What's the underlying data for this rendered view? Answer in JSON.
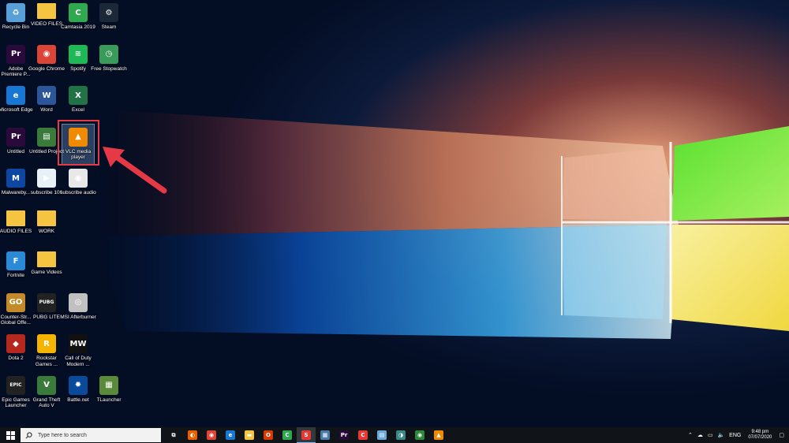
{
  "desktop": {
    "icons": [
      {
        "label": "Recycle Bin",
        "icon": "recycle-bin-icon",
        "glyph": "♻",
        "color": "#5aa0d8"
      },
      {
        "label": "VIDEO FILES",
        "icon": "folder-icon",
        "glyph": "",
        "color": "#f5c542"
      },
      {
        "label": "Camtasia 2019",
        "icon": "camtasia-icon",
        "glyph": "C",
        "color": "#2fa84f"
      },
      {
        "label": "Steam",
        "icon": "steam-icon",
        "glyph": "⚙",
        "color": "#1b2838"
      },
      {
        "label": "Adobe Premiere P...",
        "icon": "premiere-icon",
        "glyph": "Pr",
        "color": "#2a0a3a"
      },
      {
        "label": "Google Chrome",
        "icon": "chrome-icon",
        "glyph": "◉",
        "color": "#db4437"
      },
      {
        "label": "Spotify",
        "icon": "spotify-icon",
        "glyph": "≋",
        "color": "#1db954"
      },
      {
        "label": "Free Stopwatch",
        "icon": "stopwatch-icon",
        "glyph": "◷",
        "color": "#3a9a5a"
      },
      {
        "label": "Microsoft Edge",
        "icon": "edge-icon",
        "glyph": "e",
        "color": "#1877d2"
      },
      {
        "label": "Word",
        "icon": "word-icon",
        "glyph": "W",
        "color": "#2b579a"
      },
      {
        "label": "Excel",
        "icon": "excel-icon",
        "glyph": "X",
        "color": "#217346"
      },
      {
        "label": "Untitled",
        "icon": "premiere-project-icon",
        "glyph": "Pr",
        "color": "#2a0a3a"
      },
      {
        "label": "Untitled Project",
        "icon": "camtasia-project-icon",
        "glyph": "▤",
        "color": "#3a7a3a"
      },
      {
        "label": "VLC media player",
        "icon": "vlc-icon",
        "glyph": "▲",
        "color": "#f08a00"
      },
      {
        "label": "Malwareby...",
        "icon": "malwarebytes-icon",
        "glyph": "M",
        "color": "#0d47a1"
      },
      {
        "label": "subscribe 100",
        "icon": "video-file-icon",
        "glyph": "▶",
        "color": "#e8f0f8"
      },
      {
        "label": "subscribe audio",
        "icon": "audio-file-icon",
        "glyph": "◉",
        "color": "#e8e8e8"
      },
      {
        "label": "AUDIO FILES",
        "icon": "folder-icon",
        "glyph": "",
        "color": "#f5c542"
      },
      {
        "label": "WORK",
        "icon": "folder-icon",
        "glyph": "",
        "color": "#f5c542"
      },
      {
        "label": "Fortnite",
        "icon": "fortnite-icon",
        "glyph": "F",
        "color": "#2a8ad8"
      },
      {
        "label": "Game Videos",
        "icon": "folder-icon",
        "glyph": "",
        "color": "#f5c542"
      },
      {
        "label": "Counter-Str... Global Offe...",
        "icon": "csgo-icon",
        "glyph": "GO",
        "color": "#c48a2a"
      },
      {
        "label": "PUBG LITE",
        "icon": "pubg-icon",
        "glyph": "PUBG",
        "color": "#222"
      },
      {
        "label": "MSI Afterburner",
        "icon": "msi-icon",
        "glyph": "◎",
        "color": "#c0c0c0"
      },
      {
        "label": "Dota 2",
        "icon": "dota-icon",
        "glyph": "◆",
        "color": "#b5281e"
      },
      {
        "label": "Rockstar Games ...",
        "icon": "rockstar-icon",
        "glyph": "R",
        "color": "#f5b400"
      },
      {
        "label": "Call of Duty Modern ...",
        "icon": "cod-icon",
        "glyph": "MW",
        "color": "#111"
      },
      {
        "label": "Epic Games Launcher",
        "icon": "epic-icon",
        "glyph": "EPIC",
        "color": "#222"
      },
      {
        "label": "Grand Theft Auto V",
        "icon": "gta-icon",
        "glyph": "V",
        "color": "#3a7a3a"
      },
      {
        "label": "Battle.net",
        "icon": "battlenet-icon",
        "glyph": "✹",
        "color": "#0a4a9a"
      },
      {
        "label": "TLauncher",
        "icon": "tlauncher-icon",
        "glyph": "▦",
        "color": "#5a8a3a"
      }
    ]
  },
  "taskbar": {
    "search_placeholder": "Type here to search",
    "apps": [
      {
        "icon": "task-view-icon",
        "glyph": "⧉",
        "color": "#101418"
      },
      {
        "icon": "firefox-like-icon",
        "glyph": "◐",
        "color": "#e66000"
      },
      {
        "icon": "chrome-icon",
        "glyph": "◉",
        "color": "#db4437"
      },
      {
        "icon": "edge-icon",
        "glyph": "e",
        "color": "#1877d2"
      },
      {
        "icon": "file-explorer-icon",
        "glyph": "▬",
        "color": "#f5c542"
      },
      {
        "icon": "office-icon",
        "glyph": "O",
        "color": "#d83b01"
      },
      {
        "icon": "camtasia-icon",
        "glyph": "C",
        "color": "#2fa84f"
      },
      {
        "icon": "snagit-icon",
        "glyph": "S",
        "color": "#e53935"
      },
      {
        "icon": "calculator-icon",
        "glyph": "▦",
        "color": "#4a7aa8"
      },
      {
        "icon": "premiere-icon",
        "glyph": "Pr",
        "color": "#2a0a3a"
      },
      {
        "icon": "camtasia-recorder-icon",
        "glyph": "C",
        "color": "#e53935"
      },
      {
        "icon": "notepad-icon",
        "glyph": "▤",
        "color": "#6aa8d8"
      },
      {
        "icon": "network-tool-icon",
        "glyph": "◑",
        "color": "#3a8a8a"
      },
      {
        "icon": "chrome-alt-icon",
        "glyph": "◉",
        "color": "#2a8a3a"
      },
      {
        "icon": "vlc-icon",
        "glyph": "▲",
        "color": "#f08a00"
      }
    ],
    "language": "ENG",
    "time": "9:48 pm",
    "date": "07/07/2020"
  }
}
